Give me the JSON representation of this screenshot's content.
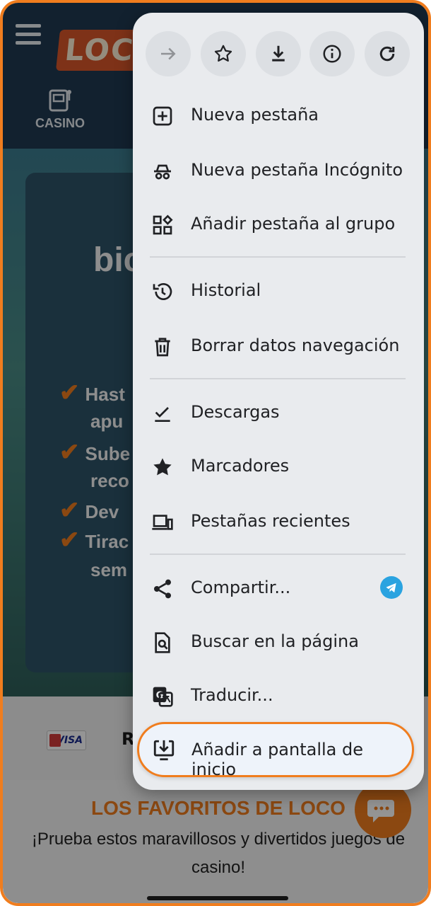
{
  "site": {
    "logo_text": "LOCO",
    "casino_tab": "CASINO",
    "hero_title": "bic",
    "bullets": [
      "Hast",
      "apu",
      "Sube",
      "reco",
      "Dev",
      "Tirac",
      "sem"
    ],
    "favorites_title": "LOS FAVORITOS DE LOCO",
    "favorites_subtitle": "¡Prueba estos maravillosos y divertidos juegos de casino!",
    "payment_visa": "VISA",
    "payment_r": "R"
  },
  "menu": {
    "toolbar": [
      {
        "name": "forward-icon",
        "enabled": false
      },
      {
        "name": "bookmark-star-icon",
        "enabled": true
      },
      {
        "name": "download-icon",
        "enabled": true
      },
      {
        "name": "info-icon",
        "enabled": true
      },
      {
        "name": "reload-icon",
        "enabled": true
      }
    ],
    "items": [
      {
        "label": "Nueva pestaña",
        "icon": "new-tab-icon"
      },
      {
        "label": "Nueva pestaña Incógnito",
        "icon": "incognito-icon"
      },
      {
        "label": "Añadir pestaña al grupo",
        "icon": "tab-group-icon"
      },
      {
        "label": "Historial",
        "icon": "history-icon"
      },
      {
        "label": "Borrar datos navegación",
        "icon": "trash-icon"
      },
      {
        "label": "Descargas",
        "icon": "downloads-icon"
      },
      {
        "label": "Marcadores",
        "icon": "bookmarks-icon"
      },
      {
        "label": "Pestañas recientes",
        "icon": "recent-tabs-icon"
      },
      {
        "label": "Compartir...",
        "icon": "share-icon"
      },
      {
        "label": "Buscar en la página",
        "icon": "find-in-page-icon"
      },
      {
        "label": "Traducir...",
        "icon": "translate-icon"
      },
      {
        "label": "Añadir a pantalla de inicio",
        "icon": "add-to-home-icon"
      }
    ]
  },
  "colors": {
    "accent": "#f07d1e",
    "menu_bg": "#e9ebee",
    "telegram": "#2aa3e0"
  }
}
